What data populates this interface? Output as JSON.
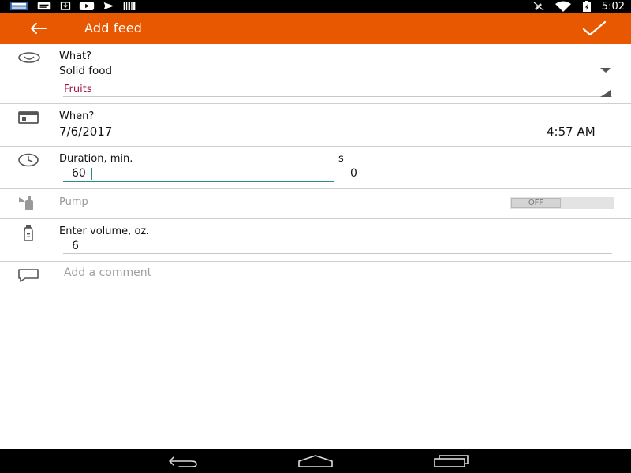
{
  "status_bar": {
    "time": "5:02",
    "left_icons": [
      "news-icon",
      "message-icon",
      "download-icon",
      "youtube-icon",
      "send-icon",
      "barcode-icon"
    ],
    "right_icons": [
      "vibrate-off-icon",
      "wifi-icon",
      "battery-charging-icon"
    ]
  },
  "app_bar": {
    "title": "Add feed",
    "back_icon": "arrow-left-icon",
    "confirm_icon": "check-icon",
    "color": "#e85800"
  },
  "what": {
    "label": "What?",
    "type_value": "Solid food",
    "subtype_value": "Fruits",
    "subtype_color": "#a0154a"
  },
  "when": {
    "label": "When?",
    "date": "7/6/2017",
    "time": "4:57 AM"
  },
  "duration": {
    "label": "Duration, min.",
    "minutes_value": "60",
    "seconds_label": "s",
    "seconds_value": "0",
    "accent": "#2a8a85"
  },
  "pump": {
    "label": "Pump",
    "toggle_state": "OFF"
  },
  "volume": {
    "label": "Enter volume, oz.",
    "value": "6"
  },
  "comment": {
    "placeholder": "Add a comment"
  },
  "nav_bar": {
    "icons": [
      "back-nav-icon",
      "home-nav-icon",
      "recents-nav-icon"
    ]
  }
}
